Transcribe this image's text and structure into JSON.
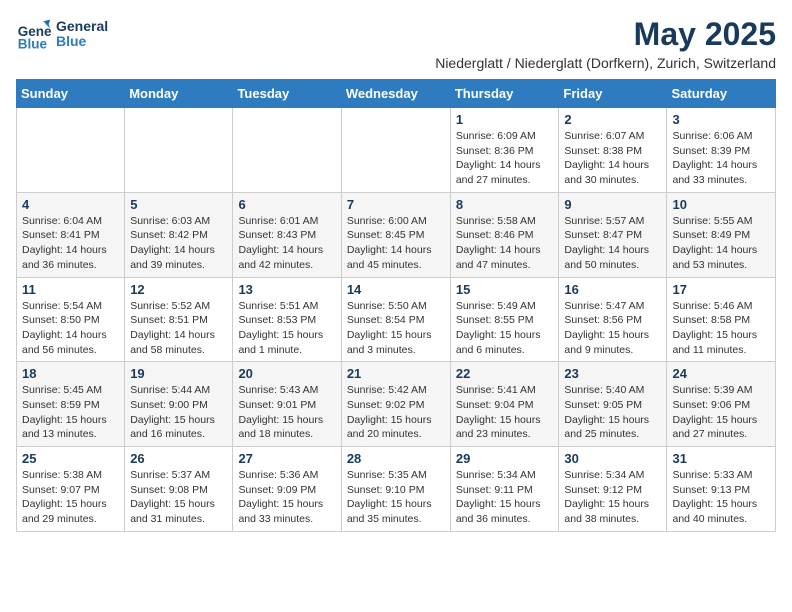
{
  "logo": {
    "line1": "General",
    "line2": "Blue"
  },
  "title": "May 2025",
  "location": "Niederglatt / Niederglatt (Dorfkern), Zurich, Switzerland",
  "weekdays": [
    "Sunday",
    "Monday",
    "Tuesday",
    "Wednesday",
    "Thursday",
    "Friday",
    "Saturday"
  ],
  "weeks": [
    [
      {
        "day": "",
        "info": ""
      },
      {
        "day": "",
        "info": ""
      },
      {
        "day": "",
        "info": ""
      },
      {
        "day": "",
        "info": ""
      },
      {
        "day": "1",
        "info": "Sunrise: 6:09 AM\nSunset: 8:36 PM\nDaylight: 14 hours\nand 27 minutes."
      },
      {
        "day": "2",
        "info": "Sunrise: 6:07 AM\nSunset: 8:38 PM\nDaylight: 14 hours\nand 30 minutes."
      },
      {
        "day": "3",
        "info": "Sunrise: 6:06 AM\nSunset: 8:39 PM\nDaylight: 14 hours\nand 33 minutes."
      }
    ],
    [
      {
        "day": "4",
        "info": "Sunrise: 6:04 AM\nSunset: 8:41 PM\nDaylight: 14 hours\nand 36 minutes."
      },
      {
        "day": "5",
        "info": "Sunrise: 6:03 AM\nSunset: 8:42 PM\nDaylight: 14 hours\nand 39 minutes."
      },
      {
        "day": "6",
        "info": "Sunrise: 6:01 AM\nSunset: 8:43 PM\nDaylight: 14 hours\nand 42 minutes."
      },
      {
        "day": "7",
        "info": "Sunrise: 6:00 AM\nSunset: 8:45 PM\nDaylight: 14 hours\nand 45 minutes."
      },
      {
        "day": "8",
        "info": "Sunrise: 5:58 AM\nSunset: 8:46 PM\nDaylight: 14 hours\nand 47 minutes."
      },
      {
        "day": "9",
        "info": "Sunrise: 5:57 AM\nSunset: 8:47 PM\nDaylight: 14 hours\nand 50 minutes."
      },
      {
        "day": "10",
        "info": "Sunrise: 5:55 AM\nSunset: 8:49 PM\nDaylight: 14 hours\nand 53 minutes."
      }
    ],
    [
      {
        "day": "11",
        "info": "Sunrise: 5:54 AM\nSunset: 8:50 PM\nDaylight: 14 hours\nand 56 minutes."
      },
      {
        "day": "12",
        "info": "Sunrise: 5:52 AM\nSunset: 8:51 PM\nDaylight: 14 hours\nand 58 minutes."
      },
      {
        "day": "13",
        "info": "Sunrise: 5:51 AM\nSunset: 8:53 PM\nDaylight: 15 hours\nand 1 minute."
      },
      {
        "day": "14",
        "info": "Sunrise: 5:50 AM\nSunset: 8:54 PM\nDaylight: 15 hours\nand 3 minutes."
      },
      {
        "day": "15",
        "info": "Sunrise: 5:49 AM\nSunset: 8:55 PM\nDaylight: 15 hours\nand 6 minutes."
      },
      {
        "day": "16",
        "info": "Sunrise: 5:47 AM\nSunset: 8:56 PM\nDaylight: 15 hours\nand 9 minutes."
      },
      {
        "day": "17",
        "info": "Sunrise: 5:46 AM\nSunset: 8:58 PM\nDaylight: 15 hours\nand 11 minutes."
      }
    ],
    [
      {
        "day": "18",
        "info": "Sunrise: 5:45 AM\nSunset: 8:59 PM\nDaylight: 15 hours\nand 13 minutes."
      },
      {
        "day": "19",
        "info": "Sunrise: 5:44 AM\nSunset: 9:00 PM\nDaylight: 15 hours\nand 16 minutes."
      },
      {
        "day": "20",
        "info": "Sunrise: 5:43 AM\nSunset: 9:01 PM\nDaylight: 15 hours\nand 18 minutes."
      },
      {
        "day": "21",
        "info": "Sunrise: 5:42 AM\nSunset: 9:02 PM\nDaylight: 15 hours\nand 20 minutes."
      },
      {
        "day": "22",
        "info": "Sunrise: 5:41 AM\nSunset: 9:04 PM\nDaylight: 15 hours\nand 23 minutes."
      },
      {
        "day": "23",
        "info": "Sunrise: 5:40 AM\nSunset: 9:05 PM\nDaylight: 15 hours\nand 25 minutes."
      },
      {
        "day": "24",
        "info": "Sunrise: 5:39 AM\nSunset: 9:06 PM\nDaylight: 15 hours\nand 27 minutes."
      }
    ],
    [
      {
        "day": "25",
        "info": "Sunrise: 5:38 AM\nSunset: 9:07 PM\nDaylight: 15 hours\nand 29 minutes."
      },
      {
        "day": "26",
        "info": "Sunrise: 5:37 AM\nSunset: 9:08 PM\nDaylight: 15 hours\nand 31 minutes."
      },
      {
        "day": "27",
        "info": "Sunrise: 5:36 AM\nSunset: 9:09 PM\nDaylight: 15 hours\nand 33 minutes."
      },
      {
        "day": "28",
        "info": "Sunrise: 5:35 AM\nSunset: 9:10 PM\nDaylight: 15 hours\nand 35 minutes."
      },
      {
        "day": "29",
        "info": "Sunrise: 5:34 AM\nSunset: 9:11 PM\nDaylight: 15 hours\nand 36 minutes."
      },
      {
        "day": "30",
        "info": "Sunrise: 5:34 AM\nSunset: 9:12 PM\nDaylight: 15 hours\nand 38 minutes."
      },
      {
        "day": "31",
        "info": "Sunrise: 5:33 AM\nSunset: 9:13 PM\nDaylight: 15 hours\nand 40 minutes."
      }
    ]
  ]
}
